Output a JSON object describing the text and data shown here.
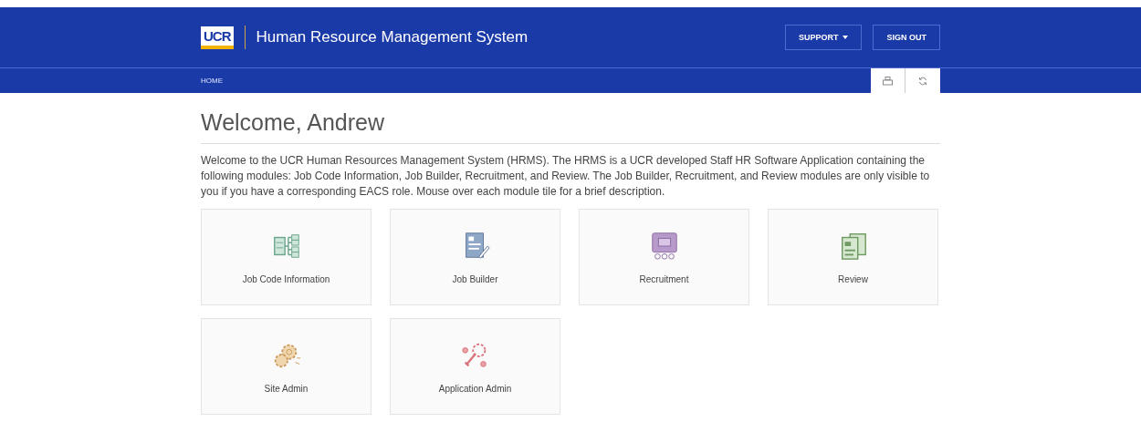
{
  "header": {
    "logo": "UCR",
    "title": "Human Resource Management System",
    "buttons": [
      {
        "label": "SUPPORT",
        "kind": "dropdown"
      },
      {
        "label": "SIGN OUT",
        "kind": "plain"
      }
    ]
  },
  "nav": {
    "breadcrumb": "HOME",
    "tools": [
      {
        "kind": "print"
      },
      {
        "kind": "refresh"
      }
    ]
  },
  "heading": "Welcome, Andrew",
  "intro": "Welcome to the UCR Human Resources Management System (HRMS). The HRMS is a UCR developed Staff HR Software Application containing the following modules: Job Code Information, Job Builder, Recruitment, and Review. The Job Builder, Recruitment, and Review modules are only visible to you if you have a corresponding EACS role. Mouse over each module tile for a brief description.",
  "modules": [
    {
      "label": "Job Code Information",
      "kind": "tree"
    },
    {
      "label": "Job Builder",
      "kind": "document"
    },
    {
      "label": "Recruitment",
      "kind": "monitor"
    },
    {
      "label": "Review",
      "kind": "pages"
    },
    {
      "label": "Site Admin",
      "kind": "gears"
    },
    {
      "label": "Application Admin",
      "kind": "tools"
    }
  ]
}
